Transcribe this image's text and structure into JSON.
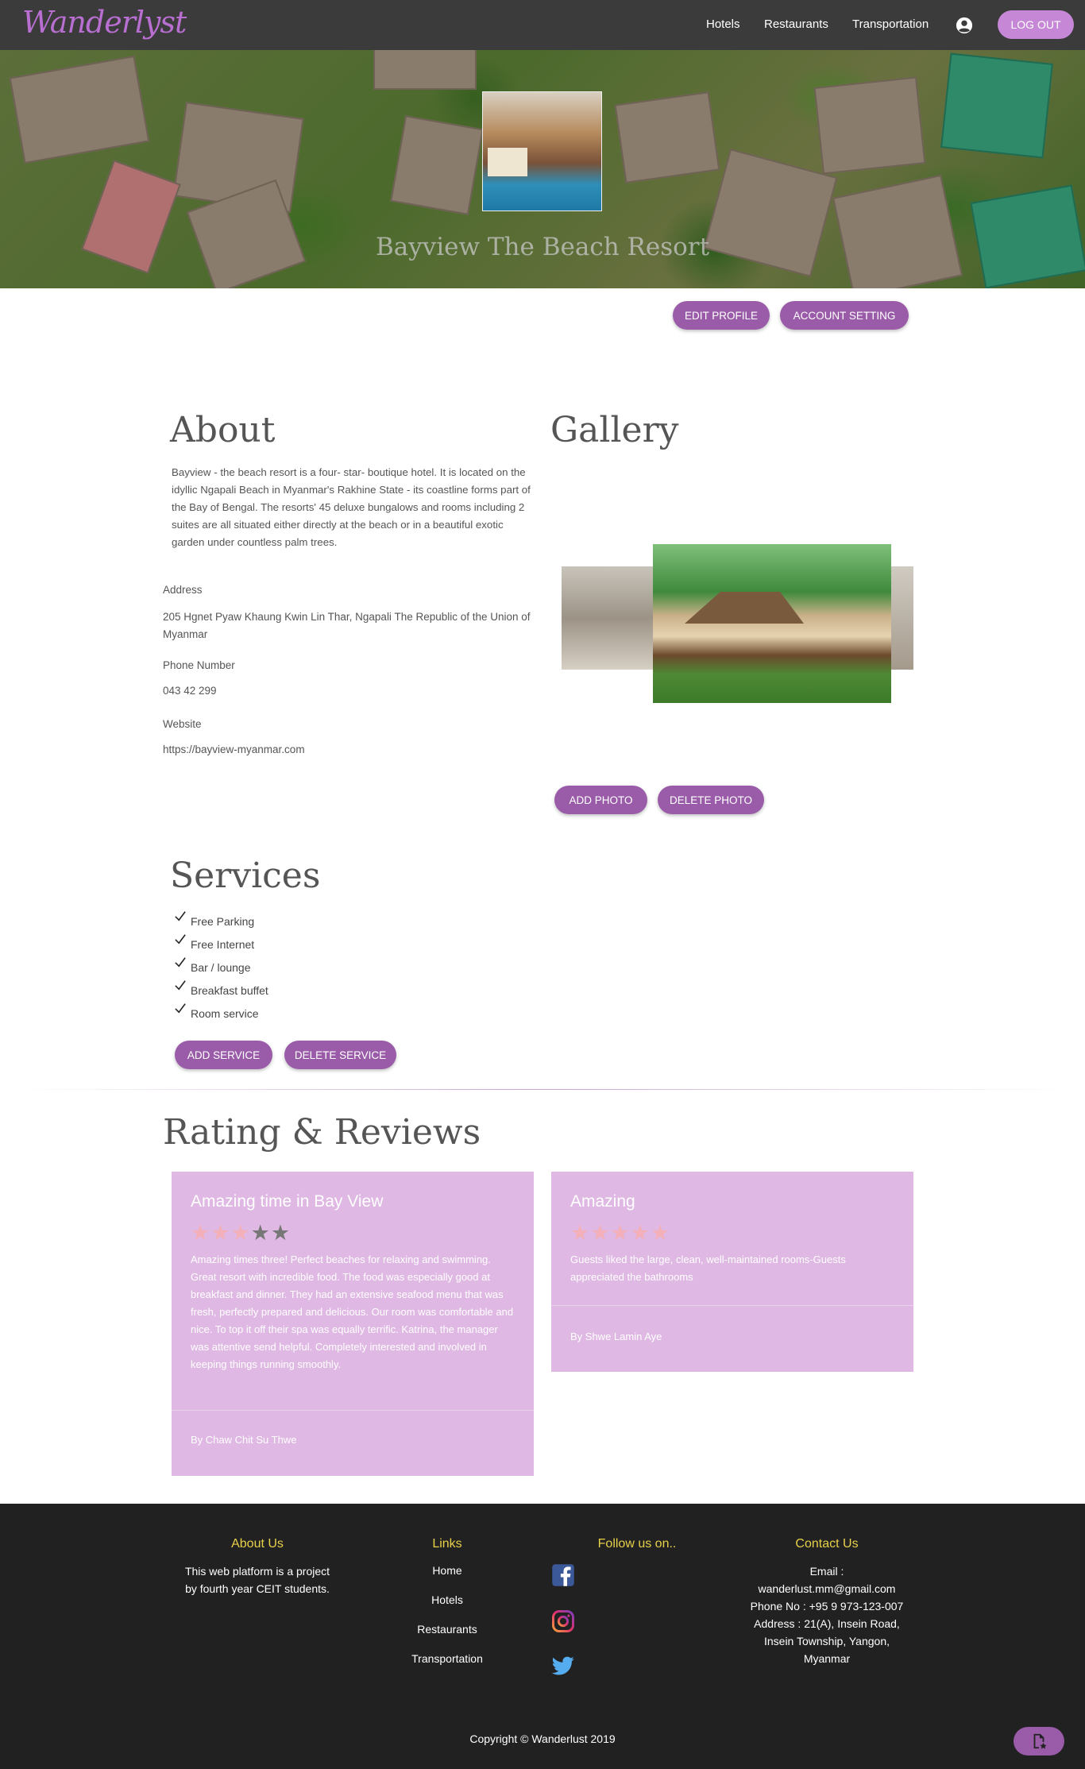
{
  "nav": {
    "logo": "Wanderlyst",
    "links": [
      "Hotels",
      "Restaurants",
      "Transportation"
    ],
    "logout_label": "LOG OUT"
  },
  "hero": {
    "title": "Bayview The Beach Resort"
  },
  "profile_actions": {
    "edit_label": "EDIT PROFILE",
    "account_label": "ACCOUNT SETTING"
  },
  "about": {
    "heading": "About",
    "text": "Bayview - the beach resort is a four- star- boutique hotel. It is located on the idyllic Ngapali Beach in Myanmar's Rakhine State - its coastline forms part of the Bay of Bengal. The resorts' 45 deluxe bungalows and rooms including 2 suites are all situated either directly at the beach or in a beautiful exotic garden under countless palm trees.",
    "address_label": "Address",
    "address_value": "205 Hgnet Pyaw Khaung Kwin Lin Thar, Ngapali The Republic of the Union of Myanmar",
    "phone_label": "Phone Number",
    "phone_value": "043 42 299",
    "website_label": "Website",
    "website_value": "https://bayview-myanmar.com"
  },
  "gallery": {
    "heading": "Gallery",
    "add_label": "ADD PHOTO",
    "delete_label": "DELETE PHOTO"
  },
  "services": {
    "heading": "Services",
    "items": [
      "Free Parking",
      "Free Internet",
      "Bar / lounge",
      "Breakfast buffet",
      "Room service"
    ],
    "add_label": "ADD SERVICE",
    "delete_label": "DELETE SERVICE"
  },
  "reviews": {
    "heading": "Rating & Reviews",
    "items": [
      {
        "title": "Amazing time in Bay View",
        "rating": 3,
        "max": 5,
        "body": "Amazing times three! Perfect beaches for relaxing and swimming. Great resort with incredible food. The food was especially good at breakfast and dinner. They had an extensive seafood menu that was fresh, perfectly prepared and delicious. Our room was comfortable and nice. To top it off their spa was equally terrific. Katrina, the manager was attentive send helpful. Completely interested and involved in keeping things running smoothly.",
        "author": "By Chaw Chit Su Thwe"
      },
      {
        "title": "Amazing",
        "rating": 5,
        "max": 5,
        "body": "Guests liked the large, clean, well-maintained rooms-Guests appreciated the bathrooms",
        "author": "By Shwe Lamin Aye"
      }
    ]
  },
  "footer": {
    "about_heading": "About Us",
    "about_text_1": "This web platform is a project",
    "about_text_2": "by fourth year CEIT students.",
    "links_heading": "Links",
    "links": [
      "Home",
      "Hotels",
      "Restaurants",
      "Transportation"
    ],
    "follow_heading": "Follow us on..",
    "social_icons": [
      "facebook-icon",
      "instagram-icon",
      "twitter-icon"
    ],
    "contact_heading": "Contact Us",
    "contact_lines": [
      "Email :",
      "wanderlust.mm@gmail.com",
      "Phone No : +95 9 973-123-007",
      "Address : 21(A), Insein Road,",
      "Insein Township, Yangon,",
      "Myanmar"
    ],
    "copyright": "Copyright © Wanderlust 2019"
  },
  "colors": {
    "nav_bg": "#3b3b3b",
    "accent": "#9a5ca8",
    "logout_bg": "#c688d6",
    "card_bg": "#dfb8e3",
    "footer_bg": "#212121",
    "footer_heading": "#e7d04a"
  }
}
